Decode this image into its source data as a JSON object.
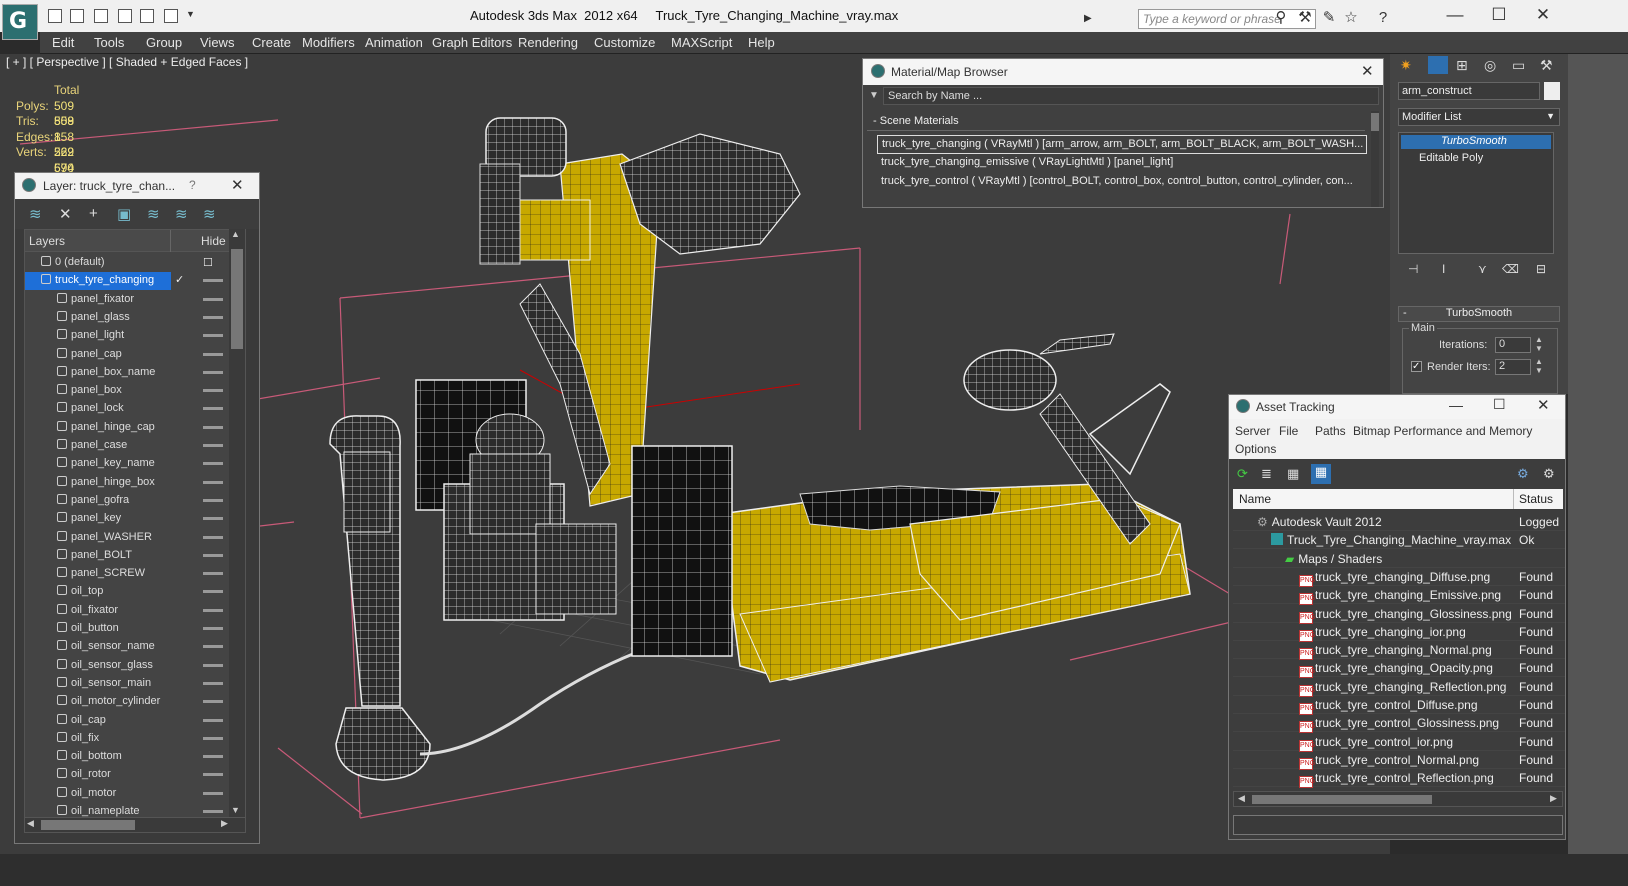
{
  "titlebar": {
    "app_title": "Autodesk 3ds Max  2012 x64",
    "file_title": "Truck_Tyre_Changing_Machine_vray.max",
    "search_placeholder": "Type a keyword or phrase"
  },
  "menu": [
    "Edit",
    "Tools",
    "Group",
    "Views",
    "Create",
    "Modifiers",
    "Animation",
    "Graph Editors",
    "Rendering",
    "Customize",
    "MAXScript",
    "Help"
  ],
  "viewport": {
    "label": "[ + ] [ Perspective ] [ Shaded + Edged Faces ]",
    "stats": {
      "total_label": "Total",
      "rows": [
        {
          "k": "Polys:",
          "v": "509 858"
        },
        {
          "k": "Tris:",
          "v": "509 858"
        },
        {
          "k": "Edges:",
          "v": "1 529 574"
        },
        {
          "k": "Verts:",
          "v": "262 690"
        }
      ]
    }
  },
  "layer_window": {
    "title": "Layer: truck_tyre_chan...",
    "help": "?",
    "col_layers": "Layers",
    "col_hide": "Hide",
    "default_layer": "0 (default)",
    "selected_layer": "truck_tyre_changing",
    "items": [
      "panel_fixator",
      "panel_glass",
      "panel_light",
      "panel_cap",
      "panel_box_name",
      "panel_box",
      "panel_lock",
      "panel_hinge_cap",
      "panel_case",
      "panel_key_name",
      "panel_hinge_box",
      "panel_gofra",
      "panel_key",
      "panel_WASHER",
      "panel_BOLT",
      "panel_SCREW",
      "oil_top",
      "oil_fixator",
      "oil_button",
      "oil_sensor_name",
      "oil_sensor_glass",
      "oil_sensor_main",
      "oil_motor_cylinder",
      "oil_cap",
      "oil_fix",
      "oil_bottom",
      "oil_rotor",
      "oil_motor",
      "oil_nameplate"
    ]
  },
  "material_browser": {
    "title": "Material/Map Browser",
    "search_placeholder": "Search by Name ...",
    "section": "Scene Materials",
    "rows": [
      "truck_tyre_changing  ( VRayMtl )  [arm_arrow, arm_BOLT, arm_BOLT_BLACK, arm_BOLT_WASH...",
      "truck_tyre_changing_emissive  ( VRayLightMtl ) [panel_light]",
      "truck_tyre_control  ( VRayMtl ) [control_BOLT, control_box, control_button, control_cylinder, con..."
    ]
  },
  "command_panel": {
    "object_name": "arm_construct",
    "modifier_list": "Modifier List",
    "stack": [
      "TurboSmooth",
      "Editable Poly"
    ],
    "rollout_title": "TurboSmooth",
    "group_main": "Main",
    "iterations_label": "Iterations:",
    "iterations_value": "0",
    "render_iters_label": "Render Iters:",
    "render_iters_value": "2"
  },
  "asset_tracking": {
    "title": "Asset Tracking",
    "menu": [
      "Server",
      "File",
      "Paths",
      "Bitmap Performance and Memory",
      "Options"
    ],
    "col_name": "Name",
    "col_status": "Status",
    "rows": [
      {
        "name": "Autodesk Vault 2012",
        "status": "Logged",
        "indent": 1,
        "kind": "vault"
      },
      {
        "name": "Truck_Tyre_Changing_Machine_vray.max",
        "status": "Ok",
        "indent": 2,
        "kind": "max"
      },
      {
        "name": "Maps / Shaders",
        "status": "",
        "indent": 3,
        "kind": "maps"
      },
      {
        "name": "truck_tyre_changing_Diffuse.png",
        "status": "Found",
        "indent": 4,
        "kind": "png"
      },
      {
        "name": "truck_tyre_changing_Emissive.png",
        "status": "Found",
        "indent": 4,
        "kind": "png"
      },
      {
        "name": "truck_tyre_changing_Glossiness.png",
        "status": "Found",
        "indent": 4,
        "kind": "png"
      },
      {
        "name": "truck_tyre_changing_ior.png",
        "status": "Found",
        "indent": 4,
        "kind": "png"
      },
      {
        "name": "truck_tyre_changing_Normal.png",
        "status": "Found",
        "indent": 4,
        "kind": "png"
      },
      {
        "name": "truck_tyre_changing_Opacity.png",
        "status": "Found",
        "indent": 4,
        "kind": "png"
      },
      {
        "name": "truck_tyre_changing_Reflection.png",
        "status": "Found",
        "indent": 4,
        "kind": "png"
      },
      {
        "name": "truck_tyre_control_Diffuse.png",
        "status": "Found",
        "indent": 4,
        "kind": "png"
      },
      {
        "name": "truck_tyre_control_Glossiness.png",
        "status": "Found",
        "indent": 4,
        "kind": "png"
      },
      {
        "name": "truck_tyre_control_ior.png",
        "status": "Found",
        "indent": 4,
        "kind": "png"
      },
      {
        "name": "truck_tyre_control_Normal.png",
        "status": "Found",
        "indent": 4,
        "kind": "png"
      },
      {
        "name": "truck_tyre_control_Reflection.png",
        "status": "Found",
        "indent": 4,
        "kind": "png"
      }
    ]
  },
  "colors": {
    "accent_select": "#1e6fd8",
    "wire_yellow": "#d4b400",
    "wire_white": "#e6e6e6",
    "stats_yellow": "#f3e27a",
    "pink_lines": "#d0607a"
  }
}
